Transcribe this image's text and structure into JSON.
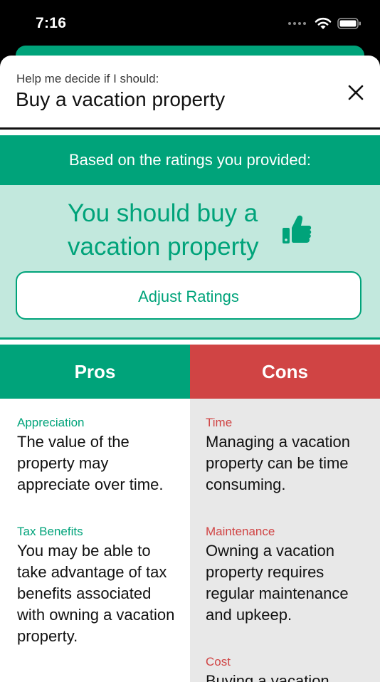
{
  "status_bar": {
    "time": "7:16",
    "signal_icon": "cellular-dots-icon",
    "wifi_icon": "wifi-icon",
    "battery_icon": "battery-icon"
  },
  "header": {
    "subtitle": "Help me decide if I should:",
    "title": "Buy a vacation property",
    "close_icon": "close-icon"
  },
  "banner": {
    "text": "Based on the ratings you provided:"
  },
  "verdict": {
    "text": "You should buy a vacation property",
    "icon": "thumbs-up-icon"
  },
  "adjust_button": {
    "label": "Adjust Ratings"
  },
  "pros": {
    "header": "Pros",
    "items": [
      {
        "title": "Appreciation",
        "description": "The value of the property may appreciate over time."
      },
      {
        "title": "Tax Benefits",
        "description": "You may be able to take advantage of tax benefits associated with owning a vacation property."
      }
    ]
  },
  "cons": {
    "header": "Cons",
    "items": [
      {
        "title": "Time",
        "description": "Managing a vacation property can be time consuming."
      },
      {
        "title": "Maintenance",
        "description": "Owning a vacation property requires regular maintenance and upkeep."
      },
      {
        "title": "Cost",
        "description": "Buying a vacation"
      }
    ]
  },
  "colors": {
    "green": "#00a37a",
    "light_green": "#c2e8dd",
    "red": "#d04444",
    "gray": "#e8e8e8"
  }
}
